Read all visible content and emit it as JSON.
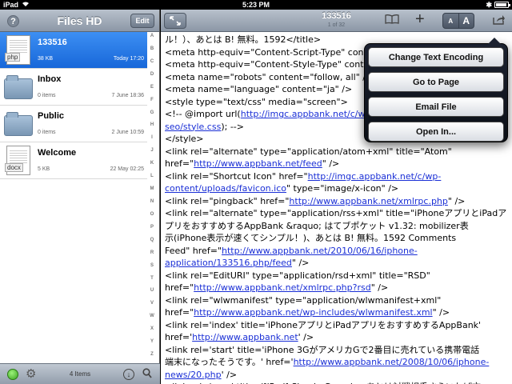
{
  "status_bar": {
    "carrier": "iPad",
    "time": "5:23 PM",
    "bluetooth": "✱",
    "battery_level": 0.8
  },
  "sidebar": {
    "title": "Files HD",
    "help_label": "?",
    "edit_label": "Edit",
    "files": [
      {
        "name": "133516",
        "size": "38 KB",
        "date": "Today 17:20",
        "kind": "doc",
        "ext": "php",
        "selected": true
      },
      {
        "name": "Inbox",
        "size": "0 items",
        "date": "7 June 18:36",
        "kind": "folder"
      },
      {
        "name": "Public",
        "size": "0 items",
        "date": "2 June 10:59",
        "kind": "folder"
      },
      {
        "name": "Welcome",
        "size": "5 KB",
        "date": "22 May 02:25",
        "kind": "doc",
        "ext": "docx"
      }
    ],
    "index": [
      "A",
      "B",
      "C",
      "D",
      "E",
      "F",
      "G",
      "H",
      "I",
      "J",
      "K",
      "L",
      "M",
      "N",
      "O",
      "P",
      "Q",
      "R",
      "S",
      "T",
      "U",
      "V",
      "W",
      "X",
      "Y",
      "Z",
      "#"
    ],
    "toolbar": {
      "items_count": "4 Items"
    }
  },
  "main": {
    "title": "133516",
    "pages": "1 of 32",
    "textsize_small": "A",
    "textsize_big": "A",
    "lines": [
      [
        {
          "t": "ル！）、あとは B! 無料。1592</title>"
        }
      ],
      [
        {
          "t": "<meta http-equiv=\"Content-Script-Type\" cont"
        }
      ],
      [
        {
          "t": "<meta http-equiv=\"Content-Style-Type\" conte"
        }
      ],
      [
        {
          "t": "<meta name=\"robots\" content=\"follow, all\" />"
        }
      ],
      [
        {
          "t": "<meta name=\"language\" content=\"ja\" />"
        }
      ],
      [
        {
          "t": "<style type=\"text/css\" media=\"screen\">"
        }
      ],
      [
        {
          "t": "<!-- @import url("
        },
        {
          "t": "http://imgc.appbank.net/c/wp",
          "link": true
        }
      ],
      [
        {
          "t": "seo/style.css",
          "link": true
        },
        {
          "t": "); -->"
        }
      ],
      [
        {
          "t": "</style>"
        }
      ],
      [
        {
          "t": "<link rel=\"alternate\" type=\"application/atom+xml\" title=\"Atom\""
        }
      ],
      [
        {
          "t": "href=\""
        },
        {
          "t": "http://www.appbank.net/feed",
          "link": true
        },
        {
          "t": "\" />"
        }
      ],
      [
        {
          "t": "<link rel=\"Shortcut Icon\" href=\""
        },
        {
          "t": "http://imgc.appbank.net/c/wp-",
          "link": true
        }
      ],
      [
        {
          "t": "content/uploads/favicon.ico",
          "link": true
        },
        {
          "t": "\" type=\"image/x-icon\" />"
        }
      ],
      [
        {
          "t": "<link rel=\"pingback\" href=\""
        },
        {
          "t": "http://www.appbank.net/xmlrpc.php",
          "link": true
        },
        {
          "t": "\" />"
        }
      ],
      [
        {
          "t": "<link rel=\"alternate\" type=\"application/rss+xml\" title=\"iPhoneアプリとiPadア"
        }
      ],
      [
        {
          "t": "プリをおすすめするAppBank &raquo; はてブポケット v1.32: mobilizer表"
        }
      ],
      [
        {
          "t": "示(iPhone表示が速くてシンプル！)、あとは B! 無料。1592 Comments"
        }
      ],
      [
        {
          "t": "Feed\" href=\""
        },
        {
          "t": "http://www.appbank.net/2010/06/16/iphone-",
          "link": true
        }
      ],
      [
        {
          "t": "application/133516.php/feed",
          "link": true
        },
        {
          "t": "\" />"
        }
      ],
      [
        {
          "t": "<link rel=\"EditURI\" type=\"application/rsd+xml\" title=\"RSD\""
        }
      ],
      [
        {
          "t": "href=\""
        },
        {
          "t": "http://www.appbank.net/xmlrpc.php?rsd",
          "link": true
        },
        {
          "t": "\" />"
        }
      ],
      [
        {
          "t": "<link rel=\"wlwmanifest\" type=\"application/wlwmanifest+xml\""
        }
      ],
      [
        {
          "t": "href=\""
        },
        {
          "t": "http://www.appbank.net/wp-includes/wlwmanifest.xml",
          "link": true
        },
        {
          "t": "\" />"
        }
      ],
      [
        {
          "t": "<link rel='index' title='iPhoneアプリとiPadアプリをおすすめするAppBank'"
        }
      ],
      [
        {
          "t": "href='"
        },
        {
          "t": "http://www.appbank.net",
          "link": true
        },
        {
          "t": "' />"
        }
      ],
      [
        {
          "t": "<link rel='start' title='iPhone 3GがアメリカGで2番目に売れている携帯電話"
        }
      ],
      [
        {
          "t": "端末になったそうです。' href='"
        },
        {
          "t": "http://www.appbank.net/2008/10/06/iphone-",
          "link": true
        }
      ],
      [
        {
          "t": "news/20.php",
          "link": true
        },
        {
          "t": "' />"
        }
      ],
      [
        {
          "t": "<link rel='prev' title='[iPad] Simply Gomoku: あとは対戦相手さえいれば文"
        }
      ]
    ]
  },
  "popover": {
    "items": [
      "Change Text Encoding",
      "Go to Page",
      "Email File",
      "Open In..."
    ]
  }
}
